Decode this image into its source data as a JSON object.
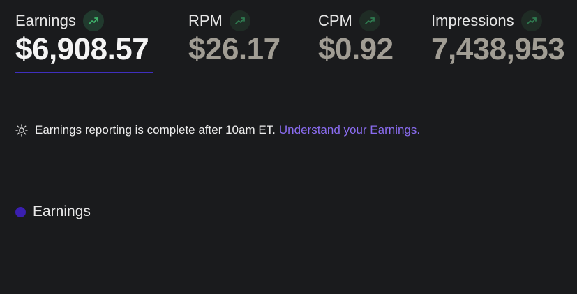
{
  "metrics": {
    "earnings": {
      "label": "Earnings",
      "value": "$6,908.57",
      "trend_icon": "trending-up-icon"
    },
    "rpm": {
      "label": "RPM",
      "value": "$26.17",
      "trend_icon": "trending-up-icon"
    },
    "cpm": {
      "label": "CPM",
      "value": "$0.92",
      "trend_icon": "trending-up-icon"
    },
    "impressions": {
      "label": "Impressions",
      "value": "7,438,953",
      "trend_icon": "trending-up-icon"
    }
  },
  "notice": {
    "icon": "sun-icon",
    "text": "Earnings reporting is complete after 10am ET.",
    "link": "Understand your Earnings."
  },
  "legend": {
    "items": [
      {
        "label": "Earnings",
        "color": "#3a1fb0"
      }
    ]
  },
  "colors": {
    "background": "#1a1b1d",
    "accent": "#3f2fbf",
    "link": "#8a6cf0",
    "trend_green": "#3fb36b",
    "inactive_value": "#a19d94"
  }
}
